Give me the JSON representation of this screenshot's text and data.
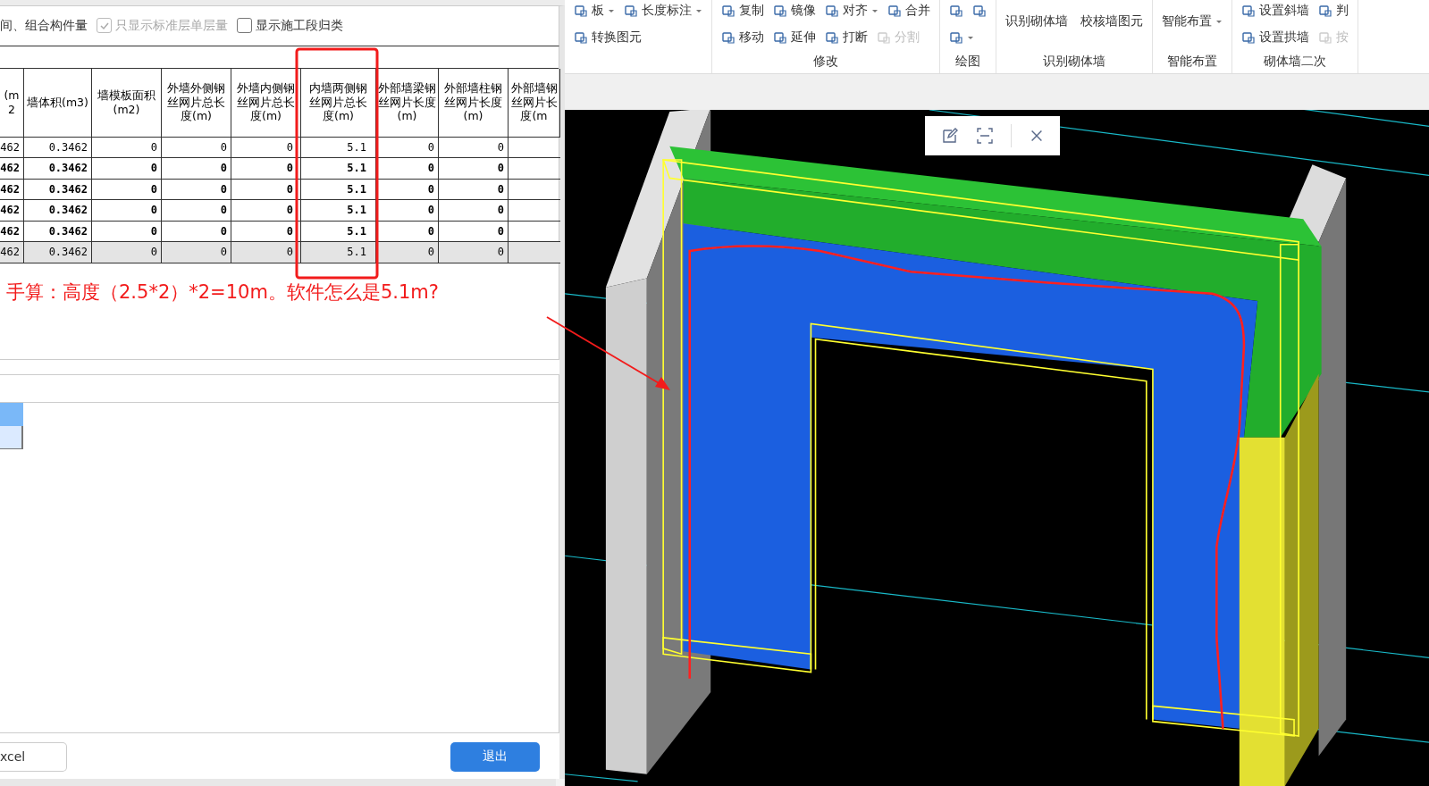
{
  "options": {
    "label": "间、组合构件量",
    "checkboxes": [
      {
        "label": "只显示标准层单层量",
        "checked": true,
        "disabled": true
      },
      {
        "label": "显示施工段归类",
        "checked": false,
        "disabled": false
      }
    ]
  },
  "table": {
    "columns": [
      "(m2",
      "墙体积(m3)",
      "墙模板面积(m2)",
      "外墙外侧钢丝网片总长度(m)",
      "外墙内侧钢丝网片总长度(m)",
      "内墙两侧钢丝网片总长度(m)",
      "外部墙梁钢丝网片长度(m)",
      "外部墙柱钢丝网片长度(m)",
      "外部墙钢丝网片长度(m"
    ],
    "rows": [
      {
        "kind": "normal",
        "cells": [
          "462",
          "0.3462",
          "0",
          "0",
          "0",
          "5.1",
          "0",
          "0"
        ]
      },
      {
        "kind": "bold",
        "cells": [
          "462",
          "0.3462",
          "0",
          "0",
          "0",
          "5.1",
          "0",
          "0"
        ]
      },
      {
        "kind": "bold",
        "cells": [
          "462",
          "0.3462",
          "0",
          "0",
          "0",
          "5.1",
          "0",
          "0"
        ]
      },
      {
        "kind": "bold",
        "cells": [
          "462",
          "0.3462",
          "0",
          "0",
          "0",
          "5.1",
          "0",
          "0"
        ]
      },
      {
        "kind": "bold",
        "cells": [
          "462",
          "0.3462",
          "0",
          "0",
          "0",
          "5.1",
          "0",
          "0"
        ]
      },
      {
        "kind": "total",
        "cells": [
          "462",
          "0.3462",
          "0",
          "0",
          "0",
          "5.1",
          "0",
          "0"
        ]
      }
    ]
  },
  "note": "手算：高度（2.5*2）*2=10m。软件怎么是5.1m?",
  "lower_grid": {
    "rows": [
      {
        "selected": true
      },
      {
        "selected": false
      }
    ]
  },
  "buttons": [
    {
      "label": "xcel",
      "kind": "secondary"
    },
    {
      "label": "退出",
      "kind": "primary"
    }
  ],
  "ribbon": {
    "groups": [
      {
        "kind": "rows",
        "rows": [
          [
            {
              "label": "板",
              "dropdown": true,
              "disabled": false
            },
            {
              "label": "长度标注",
              "dropdown": true,
              "disabled": false
            }
          ],
          [
            {
              "label": "转换图元",
              "dropdown": false,
              "disabled": false
            }
          ]
        ]
      },
      {
        "kind": "rows",
        "label": "修改",
        "rows": [
          [
            {
              "label": "复制",
              "dropdown": false,
              "disabled": false
            },
            {
              "label": "镜像",
              "dropdown": false,
              "disabled": false
            },
            {
              "label": "对齐",
              "dropdown": true,
              "disabled": false
            },
            {
              "label": "合并",
              "dropdown": false,
              "disabled": false
            }
          ],
          [
            {
              "label": "移动",
              "dropdown": false,
              "disabled": false
            },
            {
              "label": "延伸",
              "dropdown": false,
              "disabled": false
            },
            {
              "label": "打断",
              "dropdown": false,
              "disabled": false
            },
            {
              "label": "分割",
              "dropdown": false,
              "disabled": true
            }
          ]
        ]
      },
      {
        "kind": "rows",
        "label": "绘图",
        "rows": [
          [
            {
              "dropdown": false,
              "disabled": false
            },
            {
              "dropdown": false,
              "disabled": false
            }
          ],
          [
            {
              "dropdown": true,
              "disabled": false
            }
          ]
        ]
      },
      {
        "kind": "large",
        "label": "识别砌体墙",
        "rows": [
          [
            {
              "label": "识别砌体墙",
              "dropdown": false,
              "disabled": false
            },
            {
              "label": "校核墙图元",
              "dropdown": false,
              "disabled": false
            }
          ]
        ]
      },
      {
        "kind": "large",
        "label": "智能布置",
        "rows": [
          [
            {
              "label": "智能布置",
              "dropdown": true,
              "disabled": false
            }
          ]
        ]
      },
      {
        "kind": "rows",
        "label": "砌体墙二次",
        "rows": [
          [
            {
              "label": "设置斜墙",
              "dropdown": false,
              "disabled": false
            },
            {
              "label": "判",
              "dropdown": false,
              "disabled": false
            }
          ],
          [
            {
              "label": "设置拱墙",
              "dropdown": false,
              "disabled": false
            },
            {
              "label": "按",
              "dropdown": false,
              "disabled": true
            }
          ]
        ]
      }
    ]
  }
}
